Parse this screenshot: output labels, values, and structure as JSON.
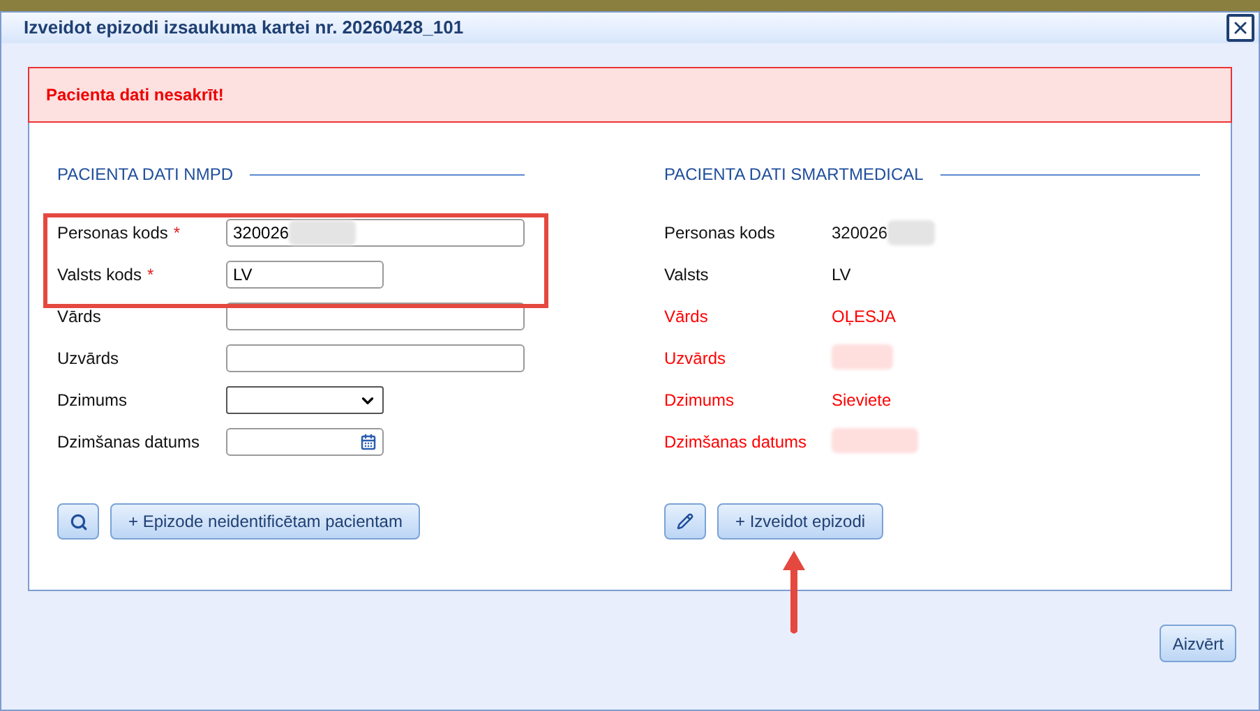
{
  "window": {
    "title": "Izveidot epizodi izsaukuma kartei nr. 20260428_101"
  },
  "alert": {
    "message": "Pacienta dati nesakrīt!"
  },
  "nmpd": {
    "heading": "PACIENTA DATI NMPD",
    "fields": [
      {
        "label": "Personas kods",
        "required_mark": "*",
        "kind": "text",
        "value": "320026",
        "redacted": true,
        "highlighted": true
      },
      {
        "label": "Valsts kods",
        "required_mark": "*",
        "kind": "short_text",
        "value": "LV",
        "redacted": false,
        "highlighted": true
      },
      {
        "label": "Vārds",
        "kind": "text",
        "redacted": false,
        "highlighted": false
      },
      {
        "label": "Uzvārds",
        "kind": "text",
        "redacted": false,
        "highlighted": false
      },
      {
        "label": "Dzimums",
        "kind": "select",
        "redacted": false,
        "highlighted": false
      },
      {
        "label": "Dzimšanas datums",
        "kind": "date",
        "redacted": false,
        "highlighted": false
      }
    ],
    "buttons": [
      {
        "kind": "search"
      },
      {
        "kind": "text",
        "label": "+ Epizode neidentificētam pacientam"
      }
    ]
  },
  "smartmedical": {
    "heading": "PACIENTA DATI SMARTMEDICAL",
    "rows": [
      {
        "label": "Personas kods",
        "value": "320026",
        "redacted": true,
        "mismatch": false
      },
      {
        "label": "Valsts",
        "value": "LV",
        "redacted": false,
        "mismatch": false
      },
      {
        "label": "Vārds",
        "value": "OĻESJA",
        "redacted": false,
        "mismatch": true
      },
      {
        "label": "Uzvārds",
        "redacted": true,
        "mismatch": true
      },
      {
        "label": "Dzimums",
        "value": "Sieviete",
        "redacted": false,
        "mismatch": true
      },
      {
        "label": "Dzimšanas datums",
        "redacted": true,
        "mismatch": true
      }
    ],
    "buttons": [
      {
        "kind": "edit"
      },
      {
        "kind": "text",
        "label": "+ Izveidot epizodi"
      }
    ]
  },
  "footer": {
    "close_button": "Aizvērt"
  }
}
